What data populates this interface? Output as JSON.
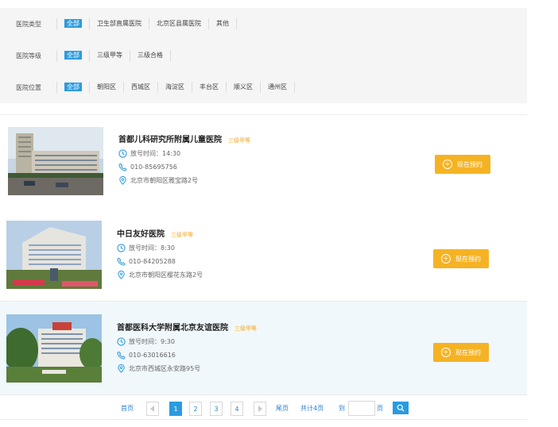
{
  "filters": [
    {
      "label": "医院类型",
      "options": [
        "全部",
        "卫生部直属医院",
        "北京区县属医院",
        "其他"
      ],
      "active": 0
    },
    {
      "label": "医院等级",
      "options": [
        "全部",
        "三级甲等",
        "三级合格"
      ],
      "active": 0
    },
    {
      "label": "医院位置",
      "options": [
        "全部",
        "朝阳区",
        "西城区",
        "海淀区",
        "丰台区",
        "顺义区",
        "通州区"
      ],
      "active": 0
    }
  ],
  "hospitals": [
    {
      "name": "首都儿科研究所附属儿童医院",
      "level": "三级甲等",
      "time": "放号时间：14:30",
      "phone": "010-85695756",
      "address": "北京市朝阳区雅宝路2号",
      "button": "现在预约"
    },
    {
      "name": "中日友好医院",
      "level": "三级甲等",
      "time": "放号时间：8:30",
      "phone": "010-84205288",
      "address": "北京市朝阳区樱花东路2号",
      "button": "现在预约"
    },
    {
      "name": "首都医科大学附属北京友谊医院",
      "level": "三级甲等",
      "time": "放号时间：9:30",
      "phone": "010-63016616",
      "address": "北京市西城区永安路95号",
      "button": "现在预约"
    }
  ],
  "pager": {
    "first": "首页",
    "pages": [
      "1",
      "2",
      "3",
      "4"
    ],
    "current": "1",
    "last": "尾页",
    "total": "共计4页",
    "goto": "到",
    "page_unit": "页"
  },
  "colors": {
    "accent": "#2b9be0",
    "button": "#f5b324",
    "level": "#f5a623"
  }
}
